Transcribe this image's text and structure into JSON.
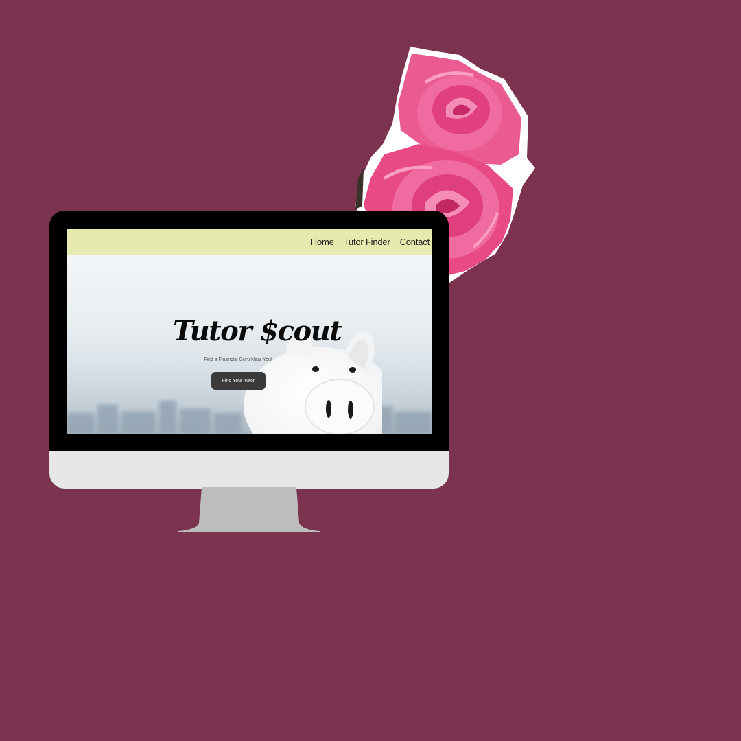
{
  "nav": {
    "items": [
      {
        "label": "Home"
      },
      {
        "label": "Tutor Finder"
      },
      {
        "label": "Contact"
      }
    ]
  },
  "hero": {
    "title": "Tutor $cout",
    "subtitle": "Find a Financial Guru Near You!",
    "cta_label": "Find Your Tutor"
  },
  "colors": {
    "background": "#7b3350",
    "navbar": "#e7eaae",
    "button": "#3a3a3a",
    "rose": "#e84a86"
  },
  "decor": {
    "flower_icon": "pink-rose-icon",
    "mascot_icon": "piggy-bank-icon"
  }
}
